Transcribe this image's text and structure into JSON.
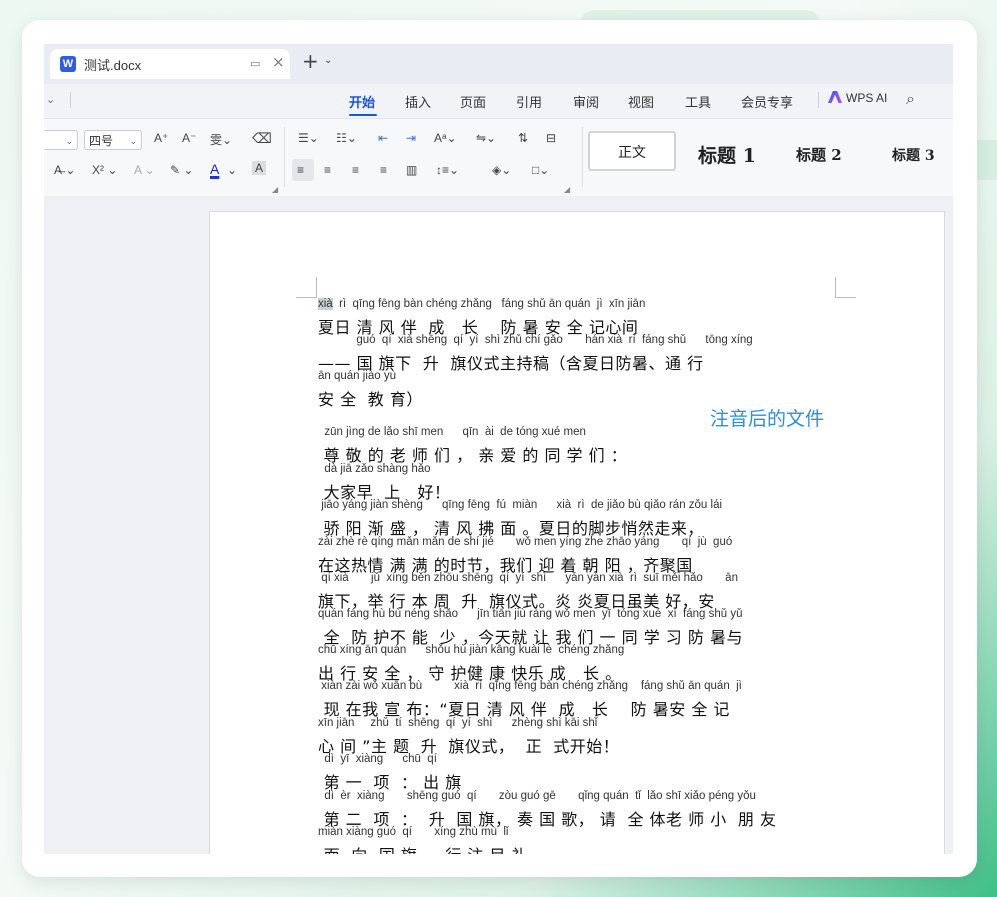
{
  "window": {
    "tab_title": "测试.docx",
    "app_logo_letter": "W"
  },
  "menu": {
    "items": [
      "开始",
      "插入",
      "页面",
      "引用",
      "审阅",
      "视图",
      "工具",
      "会员专享"
    ],
    "active": "开始",
    "wps_ai": "WPS AI"
  },
  "ribbon": {
    "font_size": "四号",
    "styles": [
      "正文",
      "标题 1",
      "标题 2",
      "标题 3"
    ]
  },
  "document": {
    "annotation": "注音后的文件",
    "lines": [
      {
        "pinyin": "xià  rì  qīng fēng bàn chéng zhǎng   fáng shǔ ān quán  jì  xīn jiān",
        "hanzi": "夏日 清 风 伴  成   长    防 暑 安 全 记心间"
      },
      {
        "pinyin": "            guó  qí  xià shēng  qí  yí  shì zhǔ chí gǎo       hán xià  rì  fáng shǔ      tōng xíng",
        "hanzi": "—— 国 旗下  升  旗仪式主持稿（含夏日防暑、通 行"
      },
      {
        "pinyin": "ān quán jiào yù",
        "hanzi": "安 全  教 育）"
      },
      {
        "pinyin": "  zūn jìng de lǎo shī men      qīn  ài  de tóng xué men",
        "hanzi": " 尊 敬 的 老 师 们 ， 亲 爱 的 同 学 们 ："
      },
      {
        "pinyin": "  dà jiā zǎo shàng hǎo",
        "hanzi": " 大家早  上   好！"
      },
      {
        "pinyin": " jiāo yáng jiàn shèng      qīng fēng  fú  miàn      xià  rì  de jiǎo bù qiǎo rán zǒu lái",
        "hanzi": " 骄 阳 渐 盛 ， 清 风 拂 面 。夏日的脚步悄然走来，"
      },
      {
        "pinyin": "zài zhè rè qíng mǎn mǎn de shí jié       wǒ men yíng zhe zhāo yáng       qí  jù  guó",
        "hanzi": "在这热情 满 满 的时节，我们 迎 着 朝 阳 ，齐聚国"
      },
      {
        "pinyin": " qí xià       jǔ  xíng běn zhōu shēng  qí  yí  shì      yán yán xià  rì  suī měi hǎo       ān",
        "hanzi": "旗下，举 行 本 周  升  旗仪式。炎 炎夏日虽美 好，安"
      },
      {
        "pinyin": "quán fáng hù bù néng shǎo      jīn tiān jiù ràng wǒ men  yī  tóng xué  xí  fáng shǔ yǔ",
        "hanzi": " 全  防 护不 能  少 ，今天就 让 我 们 一 同 学 习 防 暑与"
      },
      {
        "pinyin": "chū xíng ān quán      shǒu hù jiàn kāng kuài lè  chéng zhǎng",
        "hanzi": "出 行 安 全 ， 守 护健 康 快乐 成   长 。"
      },
      {
        "pinyin": " xiàn zài wǒ xuān bù          xià  rì  qīng fēng bàn chéng zhǎng    fáng shǔ ān quán  jì",
        "hanzi": " 现 在我 宣 布：“夏日 清 风 伴  成   长    防 暑安 全 记"
      },
      {
        "pinyin": "xīn jiān     zhǔ  tí  shēng  qí  yí  shì      zhèng shì kāi shǐ",
        "hanzi": "心 间 ”主 题  升  旗仪式，  正  式开始！"
      },
      {
        "pinyin": "  dì  yī  xiàng      chū  qí",
        "hanzi": " 第 一  项  ： 出 旗"
      },
      {
        "pinyin": "  dì  èr  xiàng       shēng guó  qí       zòu guó gē       qǐng quán  tǐ  lǎo shī xiǎo péng yǒu",
        "hanzi": " 第 二  项  ：  升  国 旗， 奏 国 歌， 请  全 体老 师 小  朋 友"
      },
      {
        "pinyin": "miàn xiàng guó  qí       xíng zhù mù  lǐ",
        "hanzi": " 面  向  国 旗，  行 注 目 礼"
      }
    ]
  }
}
